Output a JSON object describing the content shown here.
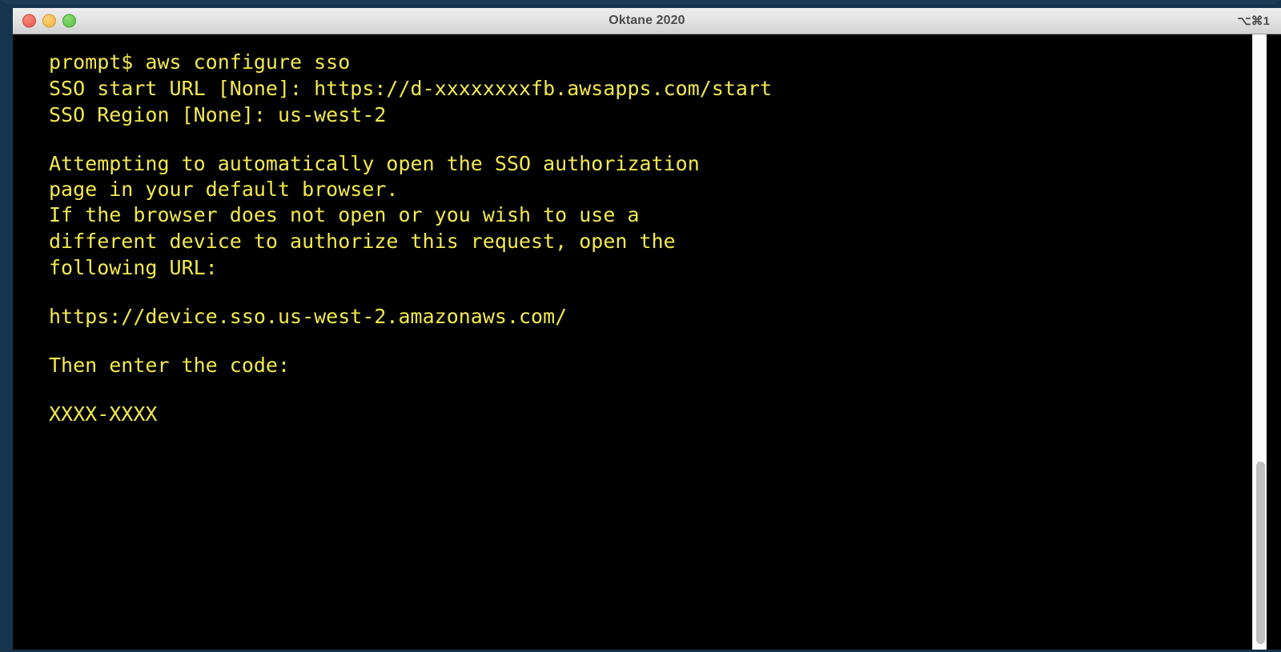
{
  "window": {
    "title": "Oktane 2020",
    "shortcut": "⌥⌘1",
    "controls": [
      {
        "name": "close",
        "color": "#e8574b"
      },
      {
        "name": "minimize",
        "color": "#f2b33e"
      },
      {
        "name": "zoom",
        "color": "#55c043"
      }
    ]
  },
  "theme": {
    "terminal_background": "#000000",
    "terminal_foreground": "#f2e94e",
    "window_border": "#16344e",
    "titlebar_background": "#e4e4e4",
    "titlebar_text": "#4c4c4c",
    "scrollbar_track": "#fbfbfb",
    "scrollbar_thumb": "#c0c0c0"
  },
  "terminal": {
    "lines": [
      {
        "id": "prompt-command",
        "text": "prompt$ aws configure sso"
      },
      {
        "id": "sso-start-url",
        "text": "SSO start URL [None]: https://d-xxxxxxxxfb.awsapps.com/start"
      },
      {
        "id": "sso-region",
        "text": "SSO Region [None]: us-west-2"
      },
      {
        "id": "blank-1",
        "text": ""
      },
      {
        "id": "attempting-1",
        "text": "Attempting to automatically open the SSO authorization"
      },
      {
        "id": "attempting-2",
        "text": "page in your default browser."
      },
      {
        "id": "fallback-1",
        "text": "If the browser does not open or you wish to use a"
      },
      {
        "id": "fallback-2",
        "text": "different device to authorize this request, open the"
      },
      {
        "id": "fallback-3",
        "text": "following URL:"
      },
      {
        "id": "blank-2",
        "text": ""
      },
      {
        "id": "device-url",
        "text": "https://device.sso.us-west-2.amazonaws.com/"
      },
      {
        "id": "blank-3",
        "text": ""
      },
      {
        "id": "code-prompt",
        "text": "Then enter the code:"
      },
      {
        "id": "blank-4",
        "text": ""
      },
      {
        "id": "device-code",
        "text": "XXXX-XXXX"
      }
    ]
  }
}
